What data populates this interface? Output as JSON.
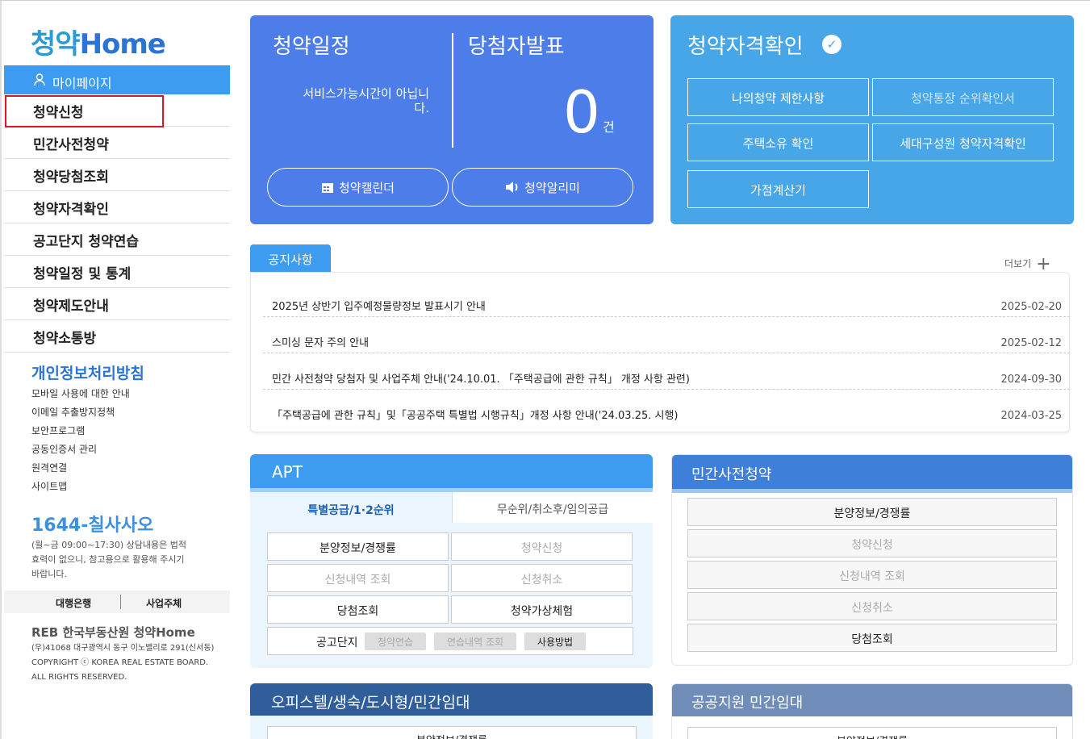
{
  "logo": {
    "mark": "청약",
    "text": "Home"
  },
  "sidebar": {
    "mypage": "마이페이지",
    "menu": [
      "청약신청",
      "민간사전청약",
      "청약당첨조회",
      "청약자격확인",
      "공고단지 청약연습",
      "청약일정 및 통계",
      "청약제도안내",
      "청약소통방"
    ],
    "policy": "개인정보처리방침",
    "links": [
      "모바일 사용에 대한 안내",
      "이메일 추출방지정책",
      "보안프로그램",
      "공동인증서 관리",
      "원격연결",
      "사이트맵"
    ],
    "phone": "1644-칠사사오",
    "phone_note": "(월~금 09:00~17:30) 상담내용은 법적효력이 없으니, 참고용으로 활용해 주시기 바랍니다.",
    "biz": {
      "bank": "대행은행",
      "company": "사업주체"
    },
    "reb": "REB 한국부동산원 청약Home",
    "address": "(우)41068 대구광역시 동구 이노밸리로 291(신서동)",
    "copyright": "COPYRIGHT ⓒ KOREA REAL ESTATE BOARD. ALL RIGHTS RESERVED."
  },
  "schedule_card": {
    "title": "청약일정",
    "winner_title": "당첨자발표",
    "service_text": "서비스가능시간이 아닙니다.",
    "count": "0",
    "unit": "건",
    "calendar_btn": "청약캘린더",
    "alarm_btn": "청약알리미"
  },
  "qualify_card": {
    "title": "청약자격확인",
    "buttons": [
      "나의청약 제한사항",
      "청약통장 순위확인서",
      "주택소유 확인",
      "세대구성원 청약자격확인",
      "가점계산기"
    ]
  },
  "notice": {
    "tab": "공지사항",
    "more": "더보기",
    "items": [
      {
        "title": "2025년 상반기 입주예정물량정보 발표시기 안내",
        "date": "2025-02-20"
      },
      {
        "title": "스미싱 문자 주의 안내",
        "date": "2025-02-12"
      },
      {
        "title": "민간 사전청약 당첨자 및 사업주체 안내('24.10.01. 「주택공급에 관한 규칙」 개정 사항 관련)",
        "date": "2024-09-30"
      },
      {
        "title": "「주택공급에 관한 규칙」및「공공주택 특별법 시행규칙」개정 사항 안내('24.03.25. 시행)",
        "date": "2024-03-25"
      }
    ]
  },
  "apt": {
    "title": "APT",
    "tab1": "특별공급/1·2순위",
    "tab2": "무순위/취소후/임의공급",
    "buttons": [
      "분양정보/경쟁률",
      "청약신청",
      "신청내역 조회",
      "신청취소",
      "당첨조회",
      "청약가상체험"
    ],
    "practice_label": "공고단지",
    "chips": [
      "청약연습",
      "연습내역 조회",
      "사용방법"
    ]
  },
  "pre": {
    "title": "민간사전청약",
    "buttons": [
      "분양정보/경쟁률",
      "청약신청",
      "신청내역 조회",
      "신청취소",
      "당첨조회"
    ]
  },
  "officetel": {
    "title": "오피스텔/생숙/도시형/민간임대",
    "first_btn": "분양정보/경쟁률"
  },
  "public_rental": {
    "title": "공공지원 민간임대",
    "first_btn": "분양정보/경쟁률"
  }
}
